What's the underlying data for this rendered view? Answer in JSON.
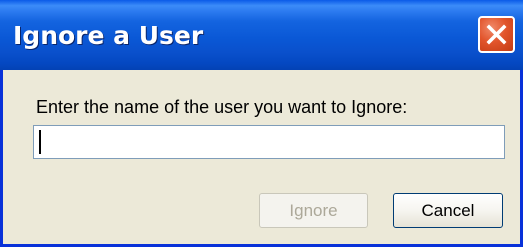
{
  "window": {
    "title": "Ignore a User",
    "close_icon": "close-icon"
  },
  "form": {
    "prompt": "Enter the name of the user you want to Ignore:",
    "username_value": ""
  },
  "buttons": {
    "ignore_label": "Ignore",
    "ignore_enabled": false,
    "cancel_label": "Cancel"
  },
  "colors": {
    "titlebar": "#0a58d6",
    "frame_border": "#0831d9",
    "dialog_background": "#ece9d8",
    "close_button": "#e2552c",
    "disabled_text": "#aca899"
  }
}
